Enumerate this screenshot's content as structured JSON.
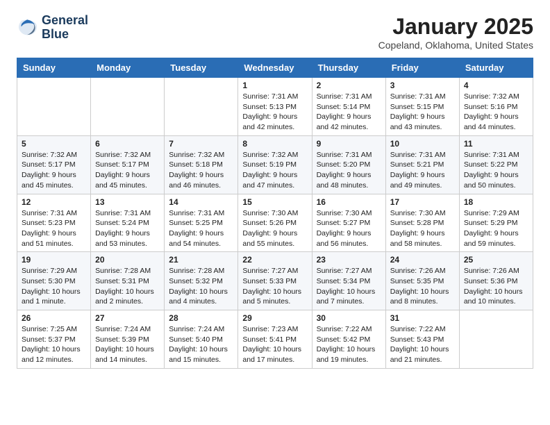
{
  "logo": {
    "line1": "General",
    "line2": "Blue"
  },
  "header": {
    "month": "January 2025",
    "location": "Copeland, Oklahoma, United States"
  },
  "weekdays": [
    "Sunday",
    "Monday",
    "Tuesday",
    "Wednesday",
    "Thursday",
    "Friday",
    "Saturday"
  ],
  "weeks": [
    [
      {
        "day": "",
        "info": ""
      },
      {
        "day": "",
        "info": ""
      },
      {
        "day": "",
        "info": ""
      },
      {
        "day": "1",
        "info": "Sunrise: 7:31 AM\nSunset: 5:13 PM\nDaylight: 9 hours\nand 42 minutes."
      },
      {
        "day": "2",
        "info": "Sunrise: 7:31 AM\nSunset: 5:14 PM\nDaylight: 9 hours\nand 42 minutes."
      },
      {
        "day": "3",
        "info": "Sunrise: 7:31 AM\nSunset: 5:15 PM\nDaylight: 9 hours\nand 43 minutes."
      },
      {
        "day": "4",
        "info": "Sunrise: 7:32 AM\nSunset: 5:16 PM\nDaylight: 9 hours\nand 44 minutes."
      }
    ],
    [
      {
        "day": "5",
        "info": "Sunrise: 7:32 AM\nSunset: 5:17 PM\nDaylight: 9 hours\nand 45 minutes."
      },
      {
        "day": "6",
        "info": "Sunrise: 7:32 AM\nSunset: 5:17 PM\nDaylight: 9 hours\nand 45 minutes."
      },
      {
        "day": "7",
        "info": "Sunrise: 7:32 AM\nSunset: 5:18 PM\nDaylight: 9 hours\nand 46 minutes."
      },
      {
        "day": "8",
        "info": "Sunrise: 7:32 AM\nSunset: 5:19 PM\nDaylight: 9 hours\nand 47 minutes."
      },
      {
        "day": "9",
        "info": "Sunrise: 7:31 AM\nSunset: 5:20 PM\nDaylight: 9 hours\nand 48 minutes."
      },
      {
        "day": "10",
        "info": "Sunrise: 7:31 AM\nSunset: 5:21 PM\nDaylight: 9 hours\nand 49 minutes."
      },
      {
        "day": "11",
        "info": "Sunrise: 7:31 AM\nSunset: 5:22 PM\nDaylight: 9 hours\nand 50 minutes."
      }
    ],
    [
      {
        "day": "12",
        "info": "Sunrise: 7:31 AM\nSunset: 5:23 PM\nDaylight: 9 hours\nand 51 minutes."
      },
      {
        "day": "13",
        "info": "Sunrise: 7:31 AM\nSunset: 5:24 PM\nDaylight: 9 hours\nand 53 minutes."
      },
      {
        "day": "14",
        "info": "Sunrise: 7:31 AM\nSunset: 5:25 PM\nDaylight: 9 hours\nand 54 minutes."
      },
      {
        "day": "15",
        "info": "Sunrise: 7:30 AM\nSunset: 5:26 PM\nDaylight: 9 hours\nand 55 minutes."
      },
      {
        "day": "16",
        "info": "Sunrise: 7:30 AM\nSunset: 5:27 PM\nDaylight: 9 hours\nand 56 minutes."
      },
      {
        "day": "17",
        "info": "Sunrise: 7:30 AM\nSunset: 5:28 PM\nDaylight: 9 hours\nand 58 minutes."
      },
      {
        "day": "18",
        "info": "Sunrise: 7:29 AM\nSunset: 5:29 PM\nDaylight: 9 hours\nand 59 minutes."
      }
    ],
    [
      {
        "day": "19",
        "info": "Sunrise: 7:29 AM\nSunset: 5:30 PM\nDaylight: 10 hours\nand 1 minute."
      },
      {
        "day": "20",
        "info": "Sunrise: 7:28 AM\nSunset: 5:31 PM\nDaylight: 10 hours\nand 2 minutes."
      },
      {
        "day": "21",
        "info": "Sunrise: 7:28 AM\nSunset: 5:32 PM\nDaylight: 10 hours\nand 4 minutes."
      },
      {
        "day": "22",
        "info": "Sunrise: 7:27 AM\nSunset: 5:33 PM\nDaylight: 10 hours\nand 5 minutes."
      },
      {
        "day": "23",
        "info": "Sunrise: 7:27 AM\nSunset: 5:34 PM\nDaylight: 10 hours\nand 7 minutes."
      },
      {
        "day": "24",
        "info": "Sunrise: 7:26 AM\nSunset: 5:35 PM\nDaylight: 10 hours\nand 8 minutes."
      },
      {
        "day": "25",
        "info": "Sunrise: 7:26 AM\nSunset: 5:36 PM\nDaylight: 10 hours\nand 10 minutes."
      }
    ],
    [
      {
        "day": "26",
        "info": "Sunrise: 7:25 AM\nSunset: 5:37 PM\nDaylight: 10 hours\nand 12 minutes."
      },
      {
        "day": "27",
        "info": "Sunrise: 7:24 AM\nSunset: 5:39 PM\nDaylight: 10 hours\nand 14 minutes."
      },
      {
        "day": "28",
        "info": "Sunrise: 7:24 AM\nSunset: 5:40 PM\nDaylight: 10 hours\nand 15 minutes."
      },
      {
        "day": "29",
        "info": "Sunrise: 7:23 AM\nSunset: 5:41 PM\nDaylight: 10 hours\nand 17 minutes."
      },
      {
        "day": "30",
        "info": "Sunrise: 7:22 AM\nSunset: 5:42 PM\nDaylight: 10 hours\nand 19 minutes."
      },
      {
        "day": "31",
        "info": "Sunrise: 7:22 AM\nSunset: 5:43 PM\nDaylight: 10 hours\nand 21 minutes."
      },
      {
        "day": "",
        "info": ""
      }
    ]
  ]
}
